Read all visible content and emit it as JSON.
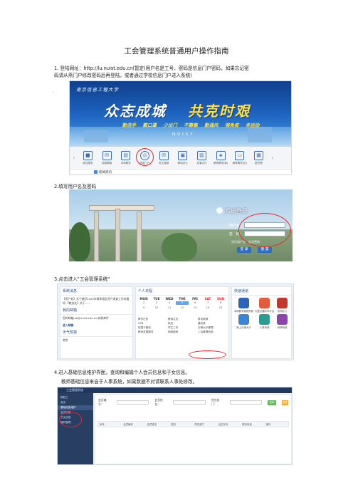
{
  "title": "工会管理系统普通用户操作指南",
  "step1": {
    "line1": "1. 登陆网址：http://lu.nuist.edu.cn(暂定)用户名是工号，密码是信息门户密码，如果忘记密",
    "line2": "码请从燕门户修改密码后再登陆，或者通过学校信息门户进入系统)"
  },
  "marker": ".",
  "portal": {
    "logo": "南京信息工程大学",
    "slogan_left": "众志成城",
    "slogan_right": "共克时艰",
    "tags": [
      "勤洗手",
      "戴口罩",
      "少出门",
      "不聚集",
      "勤通风",
      "强免疫",
      "多运动"
    ],
    "brand": "NUIST",
    "shortcuts": [
      {
        "label": "综合服务",
        "icon": "■"
      },
      {
        "label": "校园邮箱",
        "icon": "✉"
      },
      {
        "label": "本科教务",
        "icon": "▤"
      },
      {
        "label": "信息门户",
        "icon": "◎"
      },
      {
        "label": "网上报销",
        "icon": "✉"
      },
      {
        "label": "移动办公",
        "icon": "▣"
      },
      {
        "label": "办事大厅",
        "icon": "▥"
      },
      {
        "label": "教育教学(新)",
        "icon": "◈"
      },
      {
        "label": "教育教学(旧)",
        "icon": "▭"
      },
      {
        "label": "图书馆",
        "icon": "▦"
      }
    ],
    "notice": "新闻资讯"
  },
  "step2": "2.填写用户名及密码",
  "login": {
    "title": "系统登录",
    "user_label": "用户名：",
    "pass_label": "密　码：",
    "remember": "记住用户名　忘记密码",
    "login_btn": "登 录",
    "reset_btn": "重 置"
  },
  "step3": "3.点击进入\"工会管理系统\"",
  "info": {
    "left": {
      "head1": "系统消息",
      "text1": "【资产处】关于做好2020年春季固定资产清查工作的通知 【教务处】关于……",
      "head2": "我的邮箱",
      "text2": "您的邮箱(sb@nuist.edu.cn)有新邮件",
      "link2": "进入邮箱",
      "head3": "天气预报",
      "city": "南京"
    },
    "middle": {
      "head": "个人日程",
      "days": [
        "MON",
        "TUE",
        "WED",
        "THE",
        "FRI",
        "SAT",
        "SUN"
      ],
      "week1": [
        "2",
        "3",
        "4",
        "5",
        "6",
        "7",
        "8"
      ],
      "week2": [
        "9",
        "10",
        "11",
        "12",
        "13",
        "14",
        "15"
      ],
      "links": [
        "教学日历",
        "教师主页",
        "财务报销",
        "VPN",
        "校历",
        "通讯录",
        "校园卡服务",
        "学生工作",
        "办事大厅管理",
        "教师发展服务",
        "网络报修",
        "工会管理系统"
      ]
    },
    "right": {
      "head": "快速通道",
      "apps": [
        {
          "label": "本科教学管理系统",
          "color": "#2d63b8"
        },
        {
          "label": "大型仪器共享平台",
          "color": "#e25b3a"
        },
        {
          "label": "协同办公",
          "color": "#c0392b"
        },
        {
          "label": "网上办事大厅",
          "color": "#3a86d4"
        },
        {
          "label": "人事系统",
          "color": "#2a9d8f"
        },
        {
          "label": "科研系统",
          "color": "#8e44ad"
        }
      ]
    }
  },
  "step4": {
    "line1": "4.进入基础信息维护界面，查询和编辑个人会员信息和子女信息。",
    "line2": "教师基础信息来自于人事系统，如果数据不对请联系人事处修改。"
  },
  "union": {
    "header": "工会管理系统",
    "user": "教职工",
    "menu": [
      "首页",
      "基础信息维护",
      "会员信息",
      "子女信息",
      "福利管理"
    ],
    "filters": [
      "会员编号：",
      "会员姓名：",
      "所在部门："
    ],
    "query": "查询",
    "reset": "重置",
    "columns": [
      "序号",
      "会员编号",
      "会员姓名",
      "性别",
      "所在部门",
      "出生年月",
      "联系电话",
      "操作"
    ]
  }
}
